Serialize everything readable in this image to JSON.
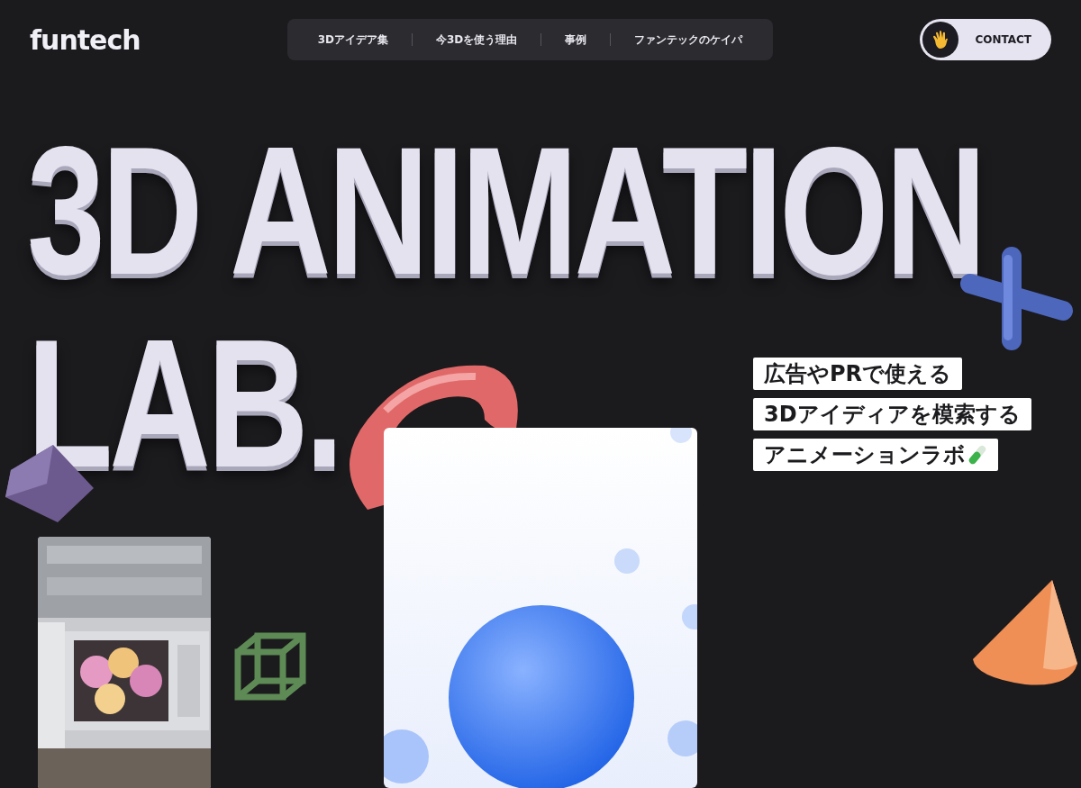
{
  "logo": "funtech",
  "nav": [
    {
      "label": "3Dアイデア集"
    },
    {
      "label": "今3Dを使う理由"
    },
    {
      "label": "事例"
    },
    {
      "label": "ファンテックのケイパ"
    }
  ],
  "contact": {
    "label": "CONTACT"
  },
  "title_lines": [
    "3D ANIMATION",
    "LAB."
  ],
  "tagline": [
    "広告やPRで使える",
    "3Dアイディアを模索する",
    "アニメーションラボ"
  ],
  "media": [
    {
      "kind": "picture"
    },
    {
      "kind": "picture"
    }
  ]
}
